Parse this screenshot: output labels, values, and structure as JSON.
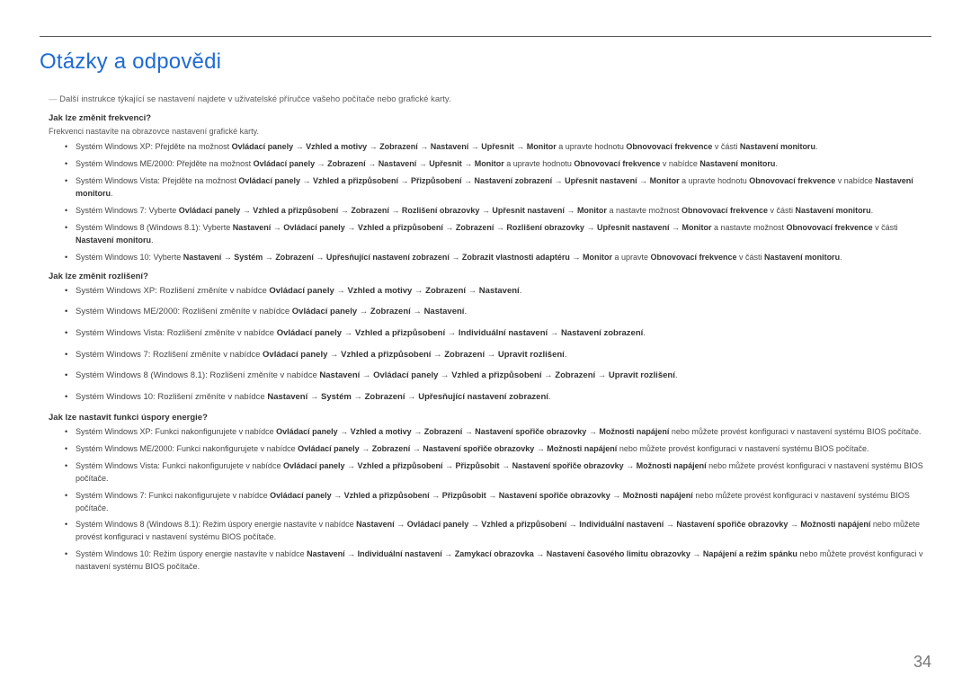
{
  "title": "Otázky a odpovědi",
  "intro": "Další instrukce týkající se nastavení najdete v uživatelské příručce vašeho počítače nebo grafické karty.",
  "arrow": "→",
  "pageNumber": "34",
  "q1": {
    "question": "Jak lze změnit frekvenci?",
    "subnote": "Frekvenci nastavíte na obrazovce nastavení grafické karty.",
    "items": [
      {
        "prefix": "Systém Windows XP: Přejděte na možnost ",
        "path": [
          "Ovládací panely",
          "Vzhled a motivy",
          "Zobrazení",
          "Nastavení",
          "Upřesnit",
          "Monitor"
        ],
        "mid": " a upravte hodnotu ",
        "setting": "Obnovovací frekvence",
        "mid2": " v části ",
        "loc": "Nastavení monitoru",
        "suffix": "."
      },
      {
        "prefix": "Systém Windows ME/2000: Přejděte na možnost ",
        "path": [
          "Ovládací panely",
          "Zobrazení",
          "Nastavení",
          "Upřesnit",
          "Monitor"
        ],
        "mid": " a upravte hodnotu ",
        "setting": "Obnovovací frekvence",
        "mid2": " v nabídce ",
        "loc": "Nastavení monitoru",
        "suffix": "."
      },
      {
        "prefix": "Systém Windows Vista: Přejděte na možnost ",
        "path": [
          "Ovládací panely",
          "Vzhled a přizpůsobení",
          "Přizpůsobení",
          "Nastavení zobrazení",
          "Upřesnit nastavení",
          "Monitor"
        ],
        "mid": " a upravte hodnotu ",
        "setting": "Obnovovací frekvence",
        "mid2": " v nabídce ",
        "loc": "Nastavení monitoru",
        "suffix": "."
      },
      {
        "prefix": "Systém Windows 7: Vyberte ",
        "path": [
          "Ovládací panely",
          "Vzhled a přizpůsobení",
          "Zobrazení",
          "Rozlišení obrazovky",
          "Upřesnit nastavení",
          "Monitor"
        ],
        "mid": " a nastavte možnost ",
        "setting": "Obnovovací frekvence",
        "mid2": " v části ",
        "loc": "Nastavení monitoru",
        "suffix": "."
      },
      {
        "prefix": "Systém Windows 8 (Windows 8.1): Vyberte ",
        "path": [
          "Nastavení",
          "Ovládací panely",
          "Vzhled a přizpůsobení",
          "Zobrazení",
          "Rozlišení obrazovky",
          "Upřesnit nastavení",
          "Monitor"
        ],
        "mid": " a nastavte možnost ",
        "setting": "Obnovovací frekvence",
        "mid2": " v části ",
        "loc": "Nastavení monitoru",
        "suffix": "."
      },
      {
        "prefix": "Systém Windows 10: Vyberte ",
        "path": [
          "Nastavení",
          "Systém",
          "Zobrazení",
          "Upřesňující nastavení zobrazení",
          "Zobrazit vlastnosti adaptéru",
          "Monitor"
        ],
        "mid": " a upravte ",
        "setting": "Obnovovací frekvence",
        "mid2": " v části ",
        "loc": "Nastavení monitoru",
        "suffix": "."
      }
    ]
  },
  "q2": {
    "question": "Jak lze změnit rozlišení?",
    "items": [
      {
        "prefix": "Systém Windows XP: Rozlišení změníte v nabídce ",
        "path": [
          "Ovládací panely",
          "Vzhled a motivy",
          "Zobrazení",
          "Nastavení"
        ],
        "suffix": "."
      },
      {
        "prefix": "Systém Windows ME/2000: Rozlišení změníte v nabídce ",
        "path": [
          "Ovládací panely",
          "Zobrazení",
          "Nastavení"
        ],
        "suffix": "."
      },
      {
        "prefix": "Systém Windows Vista: Rozlišení změníte v nabídce ",
        "path": [
          "Ovládací panely",
          "Vzhled a přizpůsobení",
          "Individuální nastavení",
          "Nastavení zobrazení"
        ],
        "suffix": "."
      },
      {
        "prefix": "Systém Windows 7: Rozlišení změníte v nabídce ",
        "path": [
          "Ovládací panely",
          "Vzhled a přizpůsobení",
          "Zobrazení",
          "Upravit rozlišení"
        ],
        "suffix": "."
      },
      {
        "prefix": "Systém Windows 8 (Windows 8.1): Rozlišení změníte v nabídce ",
        "path": [
          "Nastavení",
          "Ovládací panely",
          "Vzhled a přizpůsobení",
          "Zobrazení",
          "Upravit rozlišení"
        ],
        "suffix": "."
      },
      {
        "prefix": "Systém Windows 10: Rozlišení změníte v nabídce ",
        "path": [
          "Nastavení",
          "Systém",
          "Zobrazení",
          "Upřesňující nastavení zobrazení"
        ],
        "suffix": "."
      }
    ]
  },
  "q3": {
    "question": "Jak lze nastavit funkci úspory energie?",
    "items": [
      {
        "prefix": "Systém Windows XP: Funkci nakonfigurujete v nabídce ",
        "path": [
          "Ovládací panely",
          "Vzhled a motivy",
          "Zobrazení",
          "Nastavení spořiče obrazovky",
          "Možnosti napájení"
        ],
        "suffix": " nebo můžete provést konfiguraci v nastavení systému BIOS počítače."
      },
      {
        "prefix": "Systém Windows ME/2000: Funkci nakonfigurujete v nabídce ",
        "path": [
          "Ovládací panely",
          "Zobrazení",
          "Nastavení spořiče obrazovky",
          "Možnosti napájení"
        ],
        "suffix": " nebo můžete provést konfiguraci v nastavení systému BIOS počítače."
      },
      {
        "prefix": "Systém Windows Vista: Funkci nakonfigurujete v nabídce ",
        "path": [
          "Ovládací panely",
          "Vzhled a přizpůsobení",
          "Přizpůsobit",
          "Nastavení spořiče obrazovky",
          "Možnosti napájení"
        ],
        "suffix": " nebo můžete provést konfiguraci v nastavení systému BIOS počítače."
      },
      {
        "prefix": "Systém Windows 7: Funkci nakonfigurujete v nabídce ",
        "path": [
          "Ovládací panely",
          "Vzhled a přizpůsobení",
          "Přizpůsobit",
          "Nastavení spořiče obrazovky",
          "Možnosti napájení"
        ],
        "suffix": " nebo můžete provést konfiguraci v nastavení systému BIOS počítače."
      },
      {
        "prefix": "Systém Windows 8 (Windows 8.1): Režim úspory energie nastavíte v nabídce ",
        "path": [
          "Nastavení",
          "Ovládací panely",
          "Vzhled a přizpůsobení",
          "Individuální nastavení",
          "Nastavení spořiče obrazovky",
          "Možnosti napájení"
        ],
        "suffix": " nebo můžete provést konfiguraci v nastavení systému BIOS počítače."
      },
      {
        "prefix": "Systém Windows 10: Režim úspory energie nastavíte v nabídce ",
        "path": [
          "Nastavení",
          "Individuální nastavení",
          "Zamykací obrazovka",
          "Nastavení časového limitu obrazovky",
          "Napájení a režim spánku"
        ],
        "suffix": " nebo můžete provést konfiguraci v nastavení systému BIOS počítače."
      }
    ]
  }
}
